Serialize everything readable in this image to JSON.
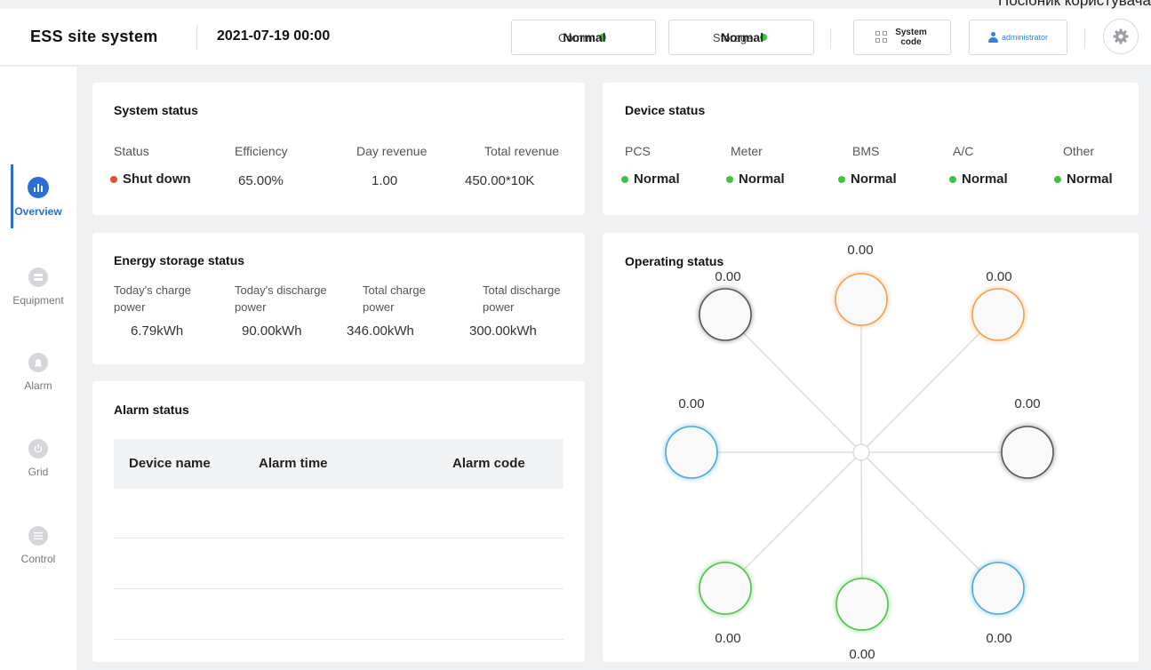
{
  "corner_text": "Посібник користувача",
  "header": {
    "app_title": "ESS site system",
    "datetime": "2021-07-19 00:00",
    "comm_label": "Comm:",
    "comm_value": "Normal",
    "storage_label": "Storage:",
    "storage_value": "Normal",
    "system_code_label": "System code",
    "user": "administrator"
  },
  "sidebar": {
    "items": [
      {
        "label": "Overview",
        "icon": "bar-chart-icon",
        "active": true
      },
      {
        "label": "Equipment",
        "icon": "server-icon",
        "active": false
      },
      {
        "label": "Alarm",
        "icon": "alarm-bell-icon",
        "active": false
      },
      {
        "label": "Grid",
        "icon": "power-icon",
        "active": false
      },
      {
        "label": "Control",
        "icon": "sliders-icon",
        "active": false
      }
    ]
  },
  "system_status": {
    "title": "System status",
    "labels": [
      "Status",
      "Efficiency",
      "Day revenue",
      "Total revenue"
    ],
    "status_value": "Shut down",
    "efficiency": "65.00%",
    "day_revenue": "1.00",
    "total_revenue": "450.00*10K"
  },
  "device_status": {
    "title": "Device status",
    "devices": [
      {
        "name": "PCS",
        "value": "Normal"
      },
      {
        "name": "Meter",
        "value": "Normal"
      },
      {
        "name": "BMS",
        "value": "Normal"
      },
      {
        "name": "A/C",
        "value": "Normal"
      },
      {
        "name": "Other",
        "value": "Normal"
      }
    ]
  },
  "energy_storage": {
    "title": "Energy storage status",
    "items": [
      {
        "label": "Today's charge power",
        "value": "6.79kWh"
      },
      {
        "label": "Today's discharge power",
        "value": "90.00kWh"
      },
      {
        "label": "Total charge power",
        "value": "346.00kWh"
      },
      {
        "label": "Total discharge power",
        "value": "300.00kWh"
      }
    ]
  },
  "alarm_status": {
    "title": "Alarm status",
    "columns": [
      "Device name",
      "Alarm time",
      "Alarm code"
    ]
  },
  "operating_status": {
    "title": "Operating status",
    "nodes": [
      {
        "value": "0.00",
        "color": "#555555"
      },
      {
        "value": "0.00",
        "color": "#f0a050"
      },
      {
        "value": "0.00",
        "color": "#f0a050"
      },
      {
        "value": "0.00",
        "color": "#4aa8dc"
      },
      {
        "value": "0.00",
        "color": "#555555"
      },
      {
        "value": "0.00",
        "color": "#4cc24c"
      },
      {
        "value": "0.00",
        "color": "#4cc24c"
      },
      {
        "value": "0.00",
        "color": "#4aa8dc"
      }
    ]
  },
  "colors": {
    "accent": "#2a6fd4",
    "ok_green": "#42c23c",
    "alert_red": "#e0542a"
  }
}
